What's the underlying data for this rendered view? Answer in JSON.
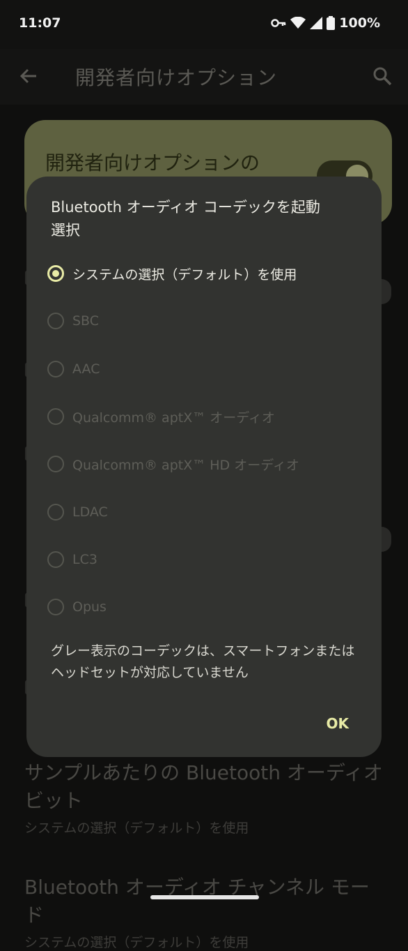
{
  "status_bar": {
    "time": "11:07",
    "battery": "100%"
  },
  "app_bar": {
    "title": "開発者向けオプション"
  },
  "dev_card": {
    "label": "開発者向けオプションの"
  },
  "background_items": [
    {
      "title_line1": "サンプルあたりの Bluetooth オーディオ",
      "title_line2": "ビット",
      "subtitle": "システムの選択（デフォルト）を使用"
    },
    {
      "title_line1": "Bluetooth オーディオ チャンネル モード",
      "subtitle": "システムの選択（デフォルト）を使用"
    }
  ],
  "dialog": {
    "title_line1": "Bluetooth オーディオ コーデックを起動",
    "title_line2": "選択",
    "options": [
      {
        "label": "システムの選択（デフォルト）を使用",
        "selected": true,
        "enabled": true
      },
      {
        "label": "SBC",
        "selected": false,
        "enabled": false
      },
      {
        "label": "AAC",
        "selected": false,
        "enabled": false
      },
      {
        "label": "Qualcomm® aptX™ オーディオ",
        "selected": false,
        "enabled": false
      },
      {
        "label": "Qualcomm® aptX™ HD オーディオ",
        "selected": false,
        "enabled": false
      },
      {
        "label": "LDAC",
        "selected": false,
        "enabled": false
      },
      {
        "label": "LC3",
        "selected": false,
        "enabled": false
      },
      {
        "label": "Opus",
        "selected": false,
        "enabled": false
      }
    ],
    "note_line1": "グレー表示のコーデックは、スマートフォンまたは",
    "note_line2": "ヘッドセットが対応していません",
    "ok_label": "OK"
  },
  "colors": {
    "accent": "#e8eba6",
    "dialog_bg": "#323330",
    "card_bg": "#5e6140"
  }
}
